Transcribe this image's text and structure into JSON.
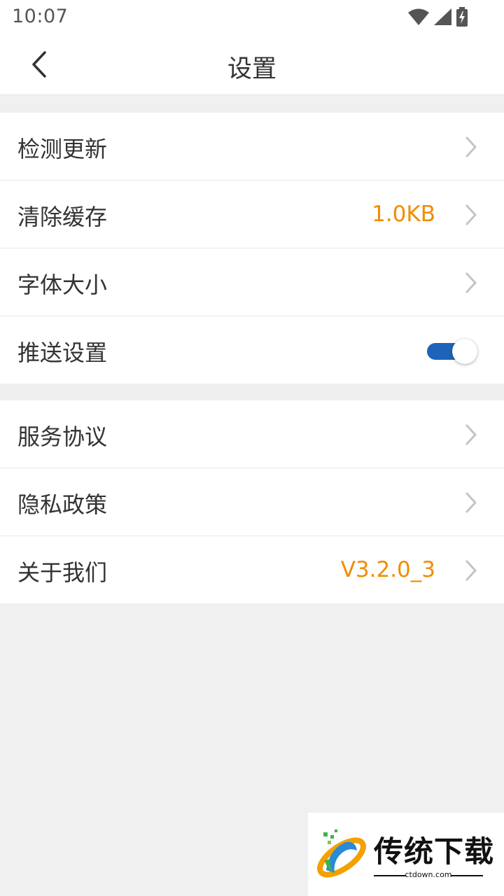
{
  "status_bar": {
    "time": "10:07",
    "icons": [
      "wifi-icon",
      "signal-icon",
      "battery-charging-icon"
    ]
  },
  "header": {
    "title": "设置",
    "back_icon": "chevron-left-icon"
  },
  "groups": [
    {
      "items": [
        {
          "label": "检测更新",
          "value": "",
          "control": "chevron"
        },
        {
          "label": "清除缓存",
          "value": "1.0KB",
          "control": "chevron"
        },
        {
          "label": "字体大小",
          "value": "",
          "control": "chevron"
        },
        {
          "label": "推送设置",
          "value": "",
          "control": "toggle",
          "toggle_on": true
        }
      ]
    },
    {
      "items": [
        {
          "label": "服务协议",
          "value": "",
          "control": "chevron"
        },
        {
          "label": "隐私政策",
          "value": "",
          "control": "chevron"
        },
        {
          "label": "关于我们",
          "value": "V3.2.0_3",
          "control": "chevron"
        }
      ]
    }
  ],
  "watermark": {
    "title": "传统下载",
    "subtitle": "ctdown.com"
  },
  "colors": {
    "accent_value": "#f08c00",
    "toggle_on": "#1e63b8",
    "background": "#f0f0f0"
  }
}
